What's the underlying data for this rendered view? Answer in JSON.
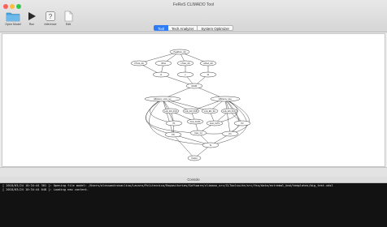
{
  "window": {
    "title": "FeReS CLIMADO Tool"
  },
  "traffic_lights": {
    "close": "#fc605b",
    "minimize": "#fdbc40",
    "zoom": "#34c84a"
  },
  "toolbar": {
    "open_model": "Open Model",
    "run": "Run",
    "inference": "Inference",
    "edit": "Edit"
  },
  "tabs": [
    "Tool",
    "Tech Analyzer",
    "System Optimizer"
  ],
  "active_tab": "Tool",
  "console": {
    "title": "Console",
    "lines": [
      "[ 2018/03/24 10:34:44 301 ]: Opening file model: /Users/alessandrosaclino/Lavoro/Politecnico/Repositories/Software/climaxo_src/CLToolsuite/src/feu/data/extremal_bnd/templates/big_test.xdsl",
      "[ 2018/03/24 10:34:44 648 ]: Loading new content."
    ]
  },
  "graph": {
    "nodes": [
      {
        "id": "n_top",
        "label": "Heatlfrom_d1t"
      },
      {
        "id": "n_a1",
        "label": "CTrust_d1t"
      },
      {
        "id": "n_a2",
        "label": "Wind"
      },
      {
        "id": "n_a3",
        "label": "LTrust_d1t"
      },
      {
        "id": "n_a4",
        "label": "Airfuel_d1t"
      },
      {
        "id": "n_b1",
        "label": "c1"
      },
      {
        "id": "n_b2",
        "label": "c"
      },
      {
        "id": "n_b3",
        "label": "k1"
      },
      {
        "id": "n_mid",
        "label": "RAUR"
      },
      {
        "id": "n_e1",
        "label": "Efficiency_cons_ren"
      },
      {
        "id": "n_e2",
        "label": "Efficiency_tree"
      },
      {
        "id": "n_f1",
        "label": "Link_EN_FUS"
      },
      {
        "id": "n_f2",
        "label": "Link_EN_FUB"
      },
      {
        "id": "n_f3",
        "label": "Link_EN_SA"
      },
      {
        "id": "n_f4",
        "label": "Link_EN_FUS"
      },
      {
        "id": "n_g1",
        "label": "P1"
      },
      {
        "id": "n_g2",
        "label": "Cost_CLRS"
      },
      {
        "id": "n_g3",
        "label": "Cost_CLTS"
      },
      {
        "id": "n_g4",
        "label": "P2"
      },
      {
        "id": "n_h1",
        "label": "PO"
      },
      {
        "id": "n_h2",
        "label": "Cost_1.0"
      },
      {
        "id": "n_h3",
        "label": "P3"
      },
      {
        "id": "n_i1",
        "label": "Te"
      },
      {
        "id": "n_out",
        "label": "Output"
      }
    ]
  }
}
